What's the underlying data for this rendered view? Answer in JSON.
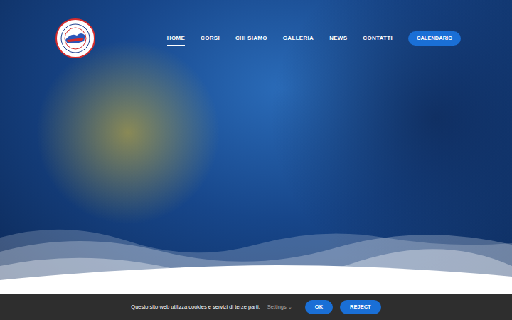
{
  "header": {
    "nav": [
      {
        "label": "HOME",
        "selected": true
      },
      {
        "label": "CORSI",
        "selected": false
      },
      {
        "label": "CHI SIAMO",
        "selected": false
      },
      {
        "label": "GALLERIA",
        "selected": false
      },
      {
        "label": "NEWS",
        "selected": false
      },
      {
        "label": "CONTATTI",
        "selected": false
      }
    ],
    "cta": "CALENDARIO"
  },
  "cookie_bar": {
    "message": "Questo sito web utilizza cookies e servizi di terze parti.",
    "settings": "Settings",
    "settings_arrow": "⌄",
    "buttons": [
      "OK",
      "REJECT"
    ]
  }
}
